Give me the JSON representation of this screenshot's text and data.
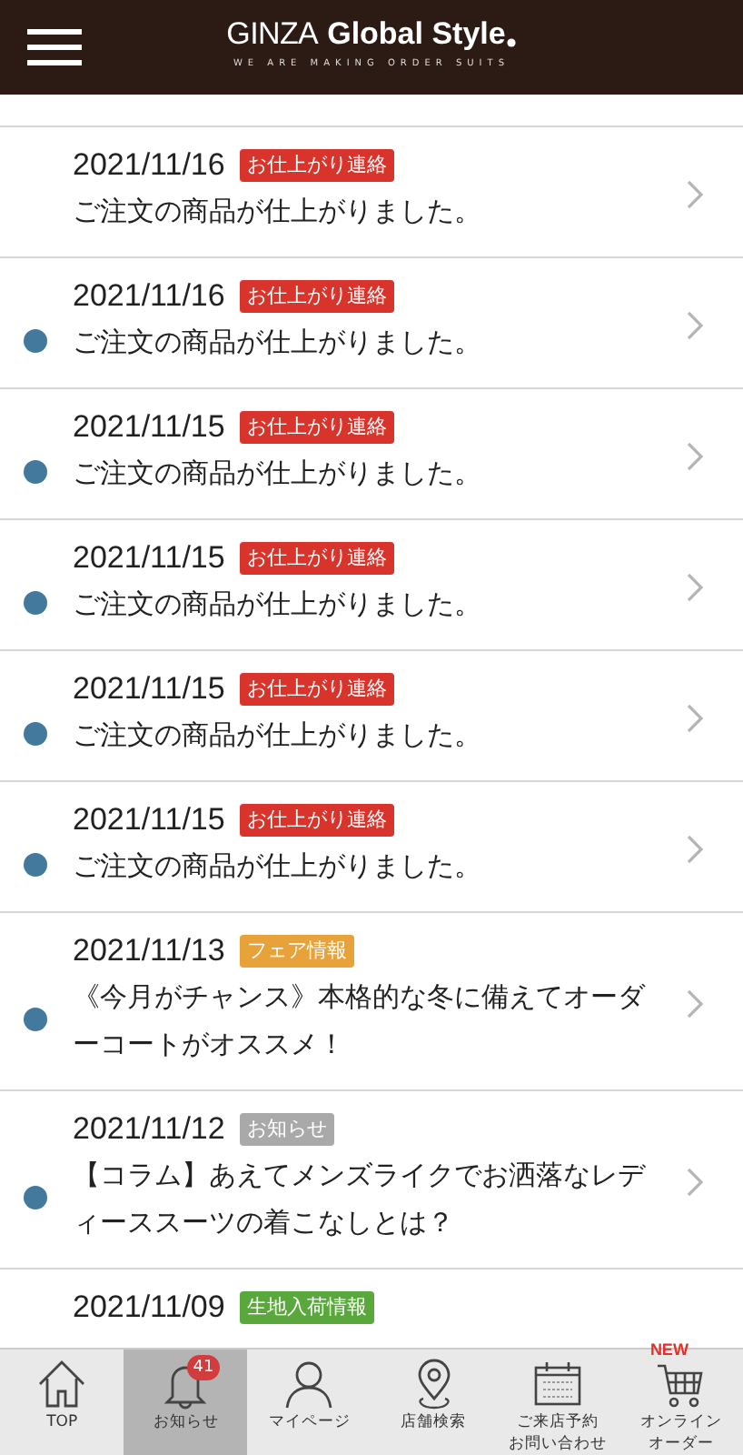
{
  "header": {
    "logo_main": "GINZA",
    "logo_bold": "Global Style",
    "logo_sub": "WE ARE MAKING ORDER SUITS"
  },
  "notices": [
    {
      "date": "2021/11/16",
      "tag": "お仕上がり連絡",
      "color": "#d9342b",
      "title": "ご注文の商品が仕上がりました。",
      "unread": false
    },
    {
      "date": "2021/11/16",
      "tag": "お仕上がり連絡",
      "color": "#d9342b",
      "title": "ご注文の商品が仕上がりました。",
      "unread": true
    },
    {
      "date": "2021/11/15",
      "tag": "お仕上がり連絡",
      "color": "#d9342b",
      "title": "ご注文の商品が仕上がりました。",
      "unread": true
    },
    {
      "date": "2021/11/15",
      "tag": "お仕上がり連絡",
      "color": "#d9342b",
      "title": "ご注文の商品が仕上がりました。",
      "unread": true
    },
    {
      "date": "2021/11/15",
      "tag": "お仕上がり連絡",
      "color": "#d9342b",
      "title": "ご注文の商品が仕上がりました。",
      "unread": true
    },
    {
      "date": "2021/11/15",
      "tag": "お仕上がり連絡",
      "color": "#d9342b",
      "title": "ご注文の商品が仕上がりました。",
      "unread": true
    },
    {
      "date": "2021/11/13",
      "tag": "フェア情報",
      "color": "#e8a23a",
      "title": "《今月がチャンス》本格的な冬に備えてオーダーコートがオススメ！",
      "unread": true
    },
    {
      "date": "2021/11/12",
      "tag": "お知らせ",
      "color": "#a9a9a9",
      "title": "【コラム】あえてメンズライクでお洒落なレディーススーツの着こなしとは？",
      "unread": true
    },
    {
      "date": "2021/11/09",
      "tag": "生地入荷情報",
      "color": "#5aa83c"
    }
  ],
  "tabs": [
    {
      "kind": "home",
      "label_lines": [
        "TOP"
      ],
      "selected": false
    },
    {
      "kind": "bell",
      "label_lines": [
        "お知らせ"
      ],
      "selected": true,
      "badge": "41"
    },
    {
      "kind": "person",
      "label_lines": [
        "マイページ"
      ],
      "selected": false
    },
    {
      "kind": "pin",
      "label_lines": [
        "店舗検索"
      ],
      "selected": false
    },
    {
      "kind": "calendar",
      "label_lines": [
        "ご来店予約",
        "お問い合わせ"
      ],
      "selected": false
    },
    {
      "kind": "cart",
      "label_lines": [
        "オンライン",
        "オーダー"
      ],
      "selected": false,
      "flag": "NEW"
    }
  ]
}
